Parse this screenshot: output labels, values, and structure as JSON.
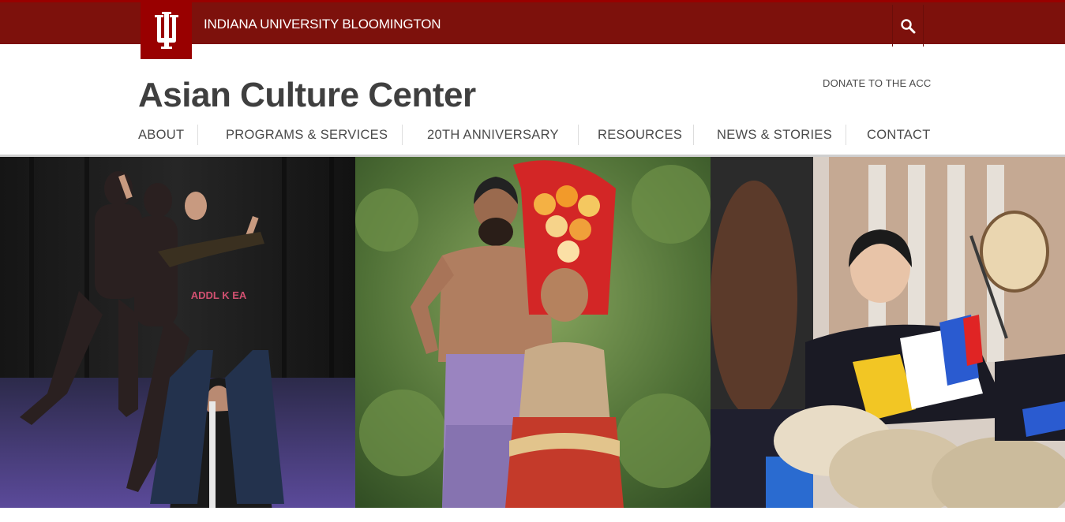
{
  "brand": {
    "university_name": "INDIANA UNIVERSITY BLOOMINGTON",
    "logo": "iu-trident-icon",
    "colors": {
      "crimson": "#990000",
      "bar": "#7d110c"
    }
  },
  "search": {
    "icon": "search-icon"
  },
  "site": {
    "title": "Asian Culture Center",
    "donate_label": "DONATE TO THE ACC"
  },
  "nav": {
    "items": [
      {
        "label": "ABOUT"
      },
      {
        "label": "PROGRAMS & SERVICES"
      },
      {
        "label": "20TH ANNIVERSARY"
      },
      {
        "label": "RESOURCES"
      },
      {
        "label": "NEWS & STORIES"
      },
      {
        "label": "CONTACT"
      }
    ]
  },
  "hero": {
    "panels": [
      {
        "subject": "dance-performance-photo",
        "text": "ADDL K EA"
      },
      {
        "subject": "pacific-islander-costume-photo"
      },
      {
        "subject": "korean-drum-performance-photo"
      }
    ]
  }
}
